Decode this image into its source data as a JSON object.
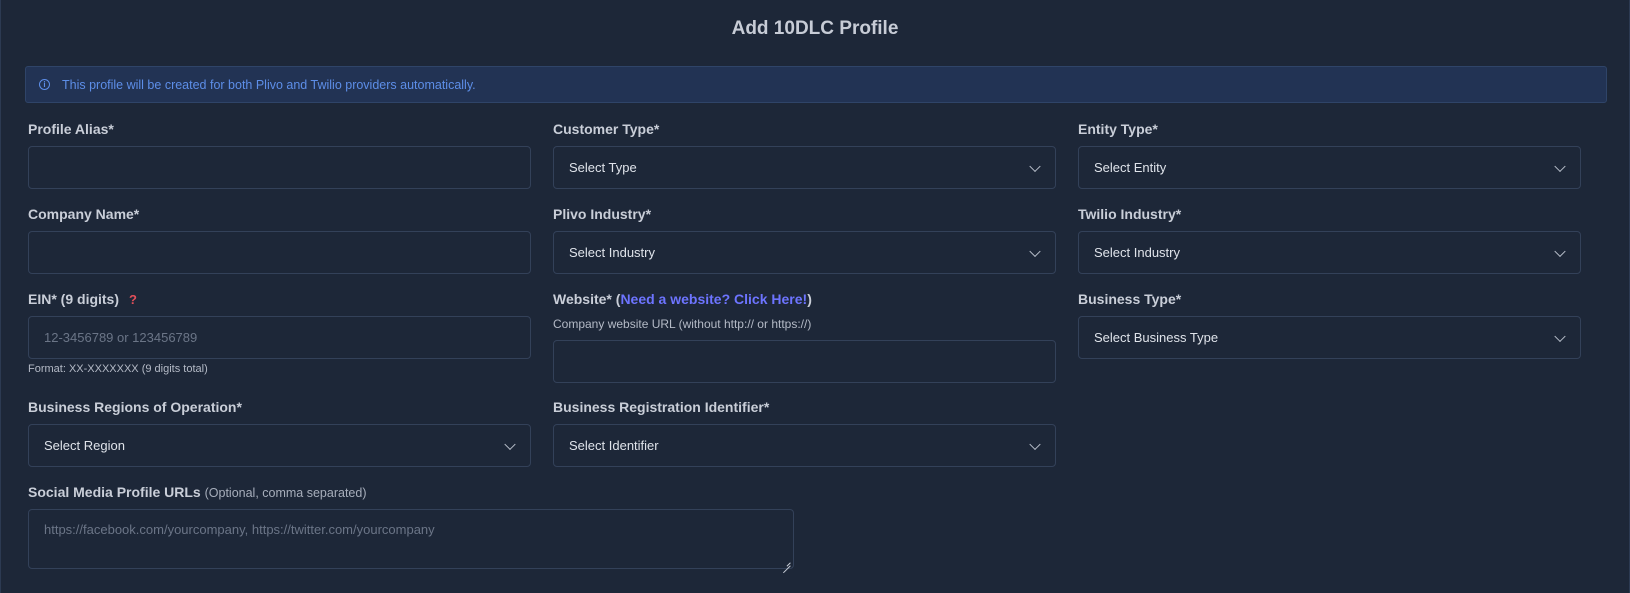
{
  "title": "Add 10DLC Profile",
  "notice": {
    "icon": "info-icon",
    "text": "This profile will be created for both Plivo and Twilio providers automatically."
  },
  "fields": {
    "profile_alias": {
      "label": "Profile Alias*",
      "value": ""
    },
    "customer_type": {
      "label": "Customer Type*",
      "value": "Select Type"
    },
    "entity_type": {
      "label": "Entity Type*",
      "value": "Select Entity"
    },
    "company_name": {
      "label": "Company Name*",
      "value": ""
    },
    "plivo_industry": {
      "label": "Plivo Industry*",
      "value": "Select Industry"
    },
    "twilio_industry": {
      "label": "Twilio Industry*",
      "value": "Select Industry"
    },
    "ein": {
      "label": "EIN* (9 digits)",
      "help_icon": "question-icon",
      "help_glyph": "?",
      "placeholder": "12-3456789 or 123456789",
      "hint": "Format: XX-XXXXXXX (9 digits total)"
    },
    "website": {
      "label": "Website* (",
      "link": "Need a website? Click Here!",
      "label_end": ")",
      "hint": "Company website URL (without http:// or https://)",
      "value": ""
    },
    "business_type": {
      "label": "Business Type*",
      "value": "Select Business Type"
    },
    "business_regions": {
      "label": "Business Regions of Operation*",
      "value": "Select Region"
    },
    "business_registration": {
      "label": "Business Registration Identifier*",
      "value": "Select Identifier"
    },
    "social_media": {
      "label": "Social Media Profile URLs",
      "label_note": "(Optional, comma separated)",
      "placeholder": "https://facebook.com/yourcompany, https://twitter.com/yourcompany"
    }
  },
  "colors": {
    "background": "#1d2738",
    "notice_bg": "#223354",
    "notice_text": "#5d8ee8",
    "link": "#6d74ff",
    "help_icon": "#e24f5a"
  }
}
